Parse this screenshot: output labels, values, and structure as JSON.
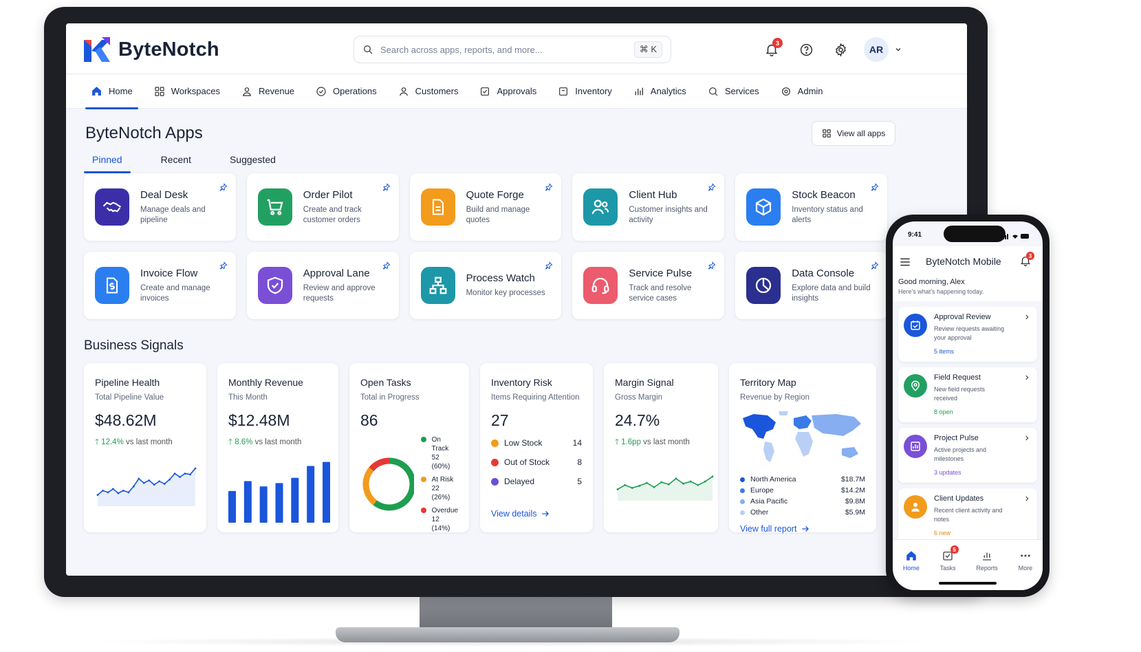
{
  "brand": {
    "name": "ByteNotch",
    "accent": "#1a56db"
  },
  "search": {
    "placeholder": "Search across apps, reports, and more...",
    "shortcut": "⌘ K"
  },
  "topbar": {
    "notification_count": "3",
    "avatar_initials": "AR"
  },
  "nav": {
    "items": [
      "Home",
      "Workspaces",
      "Revenue",
      "Operations",
      "Customers",
      "Approvals",
      "Inventory",
      "Analytics",
      "Services",
      "Admin"
    ],
    "active": "Home"
  },
  "apps_section": {
    "title": "ByteNotch Apps",
    "view_all": "View all apps",
    "tabs": [
      "Pinned",
      "Recent",
      "Suggested"
    ],
    "active_tab": "Pinned",
    "apps": [
      {
        "title": "Deal Desk",
        "desc": "Manage deals and pipeline",
        "color": "#3a2fa8",
        "icon": "handshake-icon"
      },
      {
        "title": "Order Pilot",
        "desc": "Create and track customer orders",
        "color": "#22a062",
        "icon": "cart-icon"
      },
      {
        "title": "Quote Forge",
        "desc": "Build and manage quotes",
        "color": "#f29b1d",
        "icon": "document-icon"
      },
      {
        "title": "Client Hub",
        "desc": "Customer insights and activity",
        "color": "#1d98a8",
        "icon": "users-icon"
      },
      {
        "title": "Stock Beacon",
        "desc": "Inventory status and alerts",
        "color": "#2a7ef0",
        "icon": "cube-icon"
      },
      {
        "title": "Invoice Flow",
        "desc": "Create and manage invoices",
        "color": "#2a7ef0",
        "icon": "invoice-icon"
      },
      {
        "title": "Approval Lane",
        "desc": "Review and approve requests",
        "color": "#7a4fd6",
        "icon": "shield-check-icon"
      },
      {
        "title": "Process Watch",
        "desc": "Monitor key processes",
        "color": "#1d98a8",
        "icon": "flow-icon"
      },
      {
        "title": "Service Pulse",
        "desc": "Track and resolve service cases",
        "color": "#ec5b6e",
        "icon": "headset-icon"
      },
      {
        "title": "Data Console",
        "desc": "Explore data and build insights",
        "color": "#2b2f8f",
        "icon": "pie-chart-icon"
      }
    ]
  },
  "signals": {
    "title": "Business Signals",
    "pipeline": {
      "title": "Pipeline Health",
      "sub": "Total Pipeline Value",
      "value": "$48.62M",
      "delta": "12.4%",
      "delta_text": "vs last month"
    },
    "revenue": {
      "title": "Monthly Revenue",
      "sub": "This Month",
      "value": "$12.48M",
      "delta": "8.6%",
      "delta_text": "vs last month"
    },
    "tasks": {
      "title": "Open Tasks",
      "sub": "Total in Progress",
      "value": "86",
      "legend": [
        {
          "label": "On Track",
          "detail": "52 (60%)",
          "color": "#1e9e4f"
        },
        {
          "label": "At Risk",
          "detail": "22 (26%)",
          "color": "#f29b1d"
        },
        {
          "label": "Overdue",
          "detail": "12 (14%)",
          "color": "#e53935"
        }
      ]
    },
    "inventory": {
      "title": "Inventory Risk",
      "sub": "Items Requiring Attention",
      "value": "27",
      "rows": [
        {
          "label": "Low Stock",
          "count": "14",
          "color": "#f29b1d"
        },
        {
          "label": "Out of Stock",
          "count": "8",
          "color": "#e53935"
        },
        {
          "label": "Delayed",
          "count": "5",
          "color": "#6b4fd6"
        }
      ],
      "link": "View details"
    },
    "margin": {
      "title": "Margin Signal",
      "sub": "Gross Margin",
      "value": "24.7%",
      "delta": "1.6pp",
      "delta_text": "vs last month"
    },
    "territory": {
      "title": "Territory Map",
      "sub": "Revenue by Region",
      "regions": [
        {
          "label": "North America",
          "value": "$18.7M",
          "color": "#1a56db"
        },
        {
          "label": "Europe",
          "value": "$14.2M",
          "color": "#3b7be8"
        },
        {
          "label": "Asia Pacific",
          "value": "$9.8M",
          "color": "#86aef0"
        },
        {
          "label": "Other",
          "value": "$5.9M",
          "color": "#b9cff5"
        }
      ],
      "link": "View full report"
    }
  },
  "chart_data": [
    {
      "type": "line",
      "title": "Pipeline Health",
      "values": [
        20,
        30,
        26,
        34,
        24,
        30,
        26,
        40,
        58,
        48,
        54,
        44,
        52,
        46,
        56,
        70,
        62,
        70,
        68,
        82
      ]
    },
    {
      "type": "bar",
      "title": "Monthly Revenue",
      "values": [
        48,
        63,
        55,
        60,
        68,
        86,
        92
      ]
    },
    {
      "type": "pie",
      "title": "Open Tasks",
      "categories": [
        "On Track",
        "At Risk",
        "Overdue"
      ],
      "values": [
        52,
        22,
        12
      ]
    },
    {
      "type": "line",
      "title": "Margin Signal",
      "values": [
        24,
        36,
        28,
        34,
        42,
        30,
        44,
        38,
        54,
        40,
        46,
        36,
        46,
        60
      ]
    }
  ],
  "phone": {
    "time": "9:41",
    "title": "ByteNotch Mobile",
    "notification_count": "3",
    "greeting": "Good morning, Alex",
    "subtitle": "Here's what's happening today.",
    "cards": [
      {
        "title": "Approval Review",
        "desc": "Review requests awaiting your approval",
        "meta": "5 items",
        "color": "#1a56db",
        "meta_color": "#1a56db"
      },
      {
        "title": "Field Request",
        "desc": "New field requests received",
        "meta": "8 open",
        "color": "#22a062",
        "meta_color": "#1e9e4f"
      },
      {
        "title": "Project Pulse",
        "desc": "Active projects and milestones",
        "meta": "3 updates",
        "color": "#7a4fd6",
        "meta_color": "#7a4fd6"
      },
      {
        "title": "Client Updates",
        "desc": "Recent client activity and notes",
        "meta": "6 new",
        "color": "#f29b1d",
        "meta_color": "#e08a0a"
      }
    ],
    "tabs": [
      "Home",
      "Tasks",
      "Reports",
      "More"
    ],
    "tasks_badge": "5"
  }
}
